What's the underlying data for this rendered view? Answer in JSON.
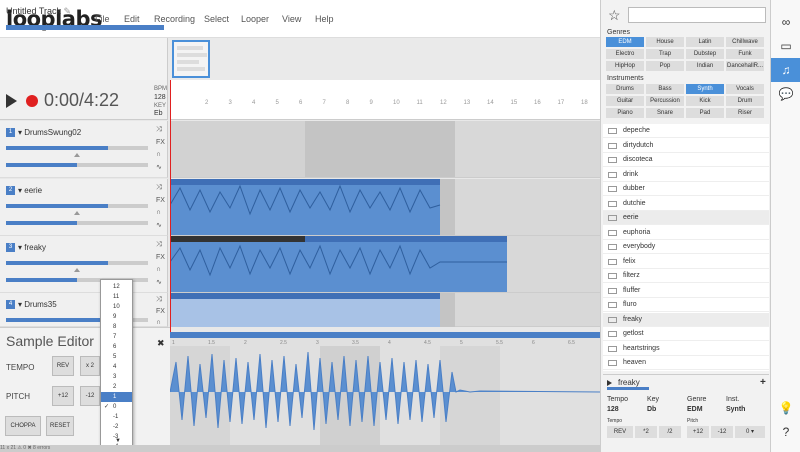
{
  "app": {
    "logo": "looplabs"
  },
  "menu": [
    "File",
    "Edit",
    "Recording",
    "Select",
    "Looper",
    "View",
    "Help"
  ],
  "track": {
    "title": "Untitled Track"
  },
  "transport": {
    "time": "0:00/4:22",
    "bpm_label": "BPM",
    "bpm": "128",
    "key_label": "KEY",
    "key": "Eb"
  },
  "ruler": {
    "ticks": [
      "2",
      "3",
      "4",
      "5",
      "6",
      "7",
      "8",
      "9",
      "10",
      "11",
      "12",
      "13",
      "14",
      "15",
      "16",
      "17",
      "18"
    ]
  },
  "tracks": [
    {
      "num": "1",
      "name": "DrumsSwung02",
      "volume": 0.72,
      "pan": 0.5
    },
    {
      "num": "2",
      "name": "eerie",
      "volume": 0.72,
      "pan": 0.5
    },
    {
      "num": "3",
      "name": "freaky",
      "volume": 0.72,
      "pan": 0.5
    },
    {
      "num": "4",
      "name": "Drums35",
      "volume": 0.72,
      "pan": 0.5
    }
  ],
  "track_icons": {
    "fx": "FX"
  },
  "sample_editor": {
    "title": "Sample Editor",
    "tempo_label": "TEMPO",
    "pitch_label": "PITCH",
    "rev": "REV",
    "x2": "x 2",
    "plus12": "+12",
    "minus12": "-12",
    "choppa": "CHOPPA",
    "reset": "RESET",
    "close": "✖"
  },
  "lower_ruler": {
    "ticks": [
      "1",
      "1.5",
      "2",
      "2.5",
      "3",
      "3.5",
      "4",
      "4.5",
      "5",
      "5.5",
      "6",
      "6.5"
    ]
  },
  "pitch_dropdown": {
    "options": [
      "12",
      "11",
      "10",
      "9",
      "8",
      "7",
      "6",
      "5",
      "4",
      "3",
      "2",
      "1",
      "0",
      "-1",
      "-2",
      "-3",
      "-4"
    ],
    "selected": "1",
    "checked": "0",
    "more": "▼"
  },
  "statusbar": {
    "text": "11   x 21   ⚠ 0   ✖ 8 errors"
  },
  "browser": {
    "genres_label": "Genres",
    "genres": [
      {
        "label": "EDM",
        "on": true
      },
      {
        "label": "House"
      },
      {
        "label": "Latin"
      },
      {
        "label": "Chillwave"
      },
      {
        "label": "Electro"
      },
      {
        "label": "Trap"
      },
      {
        "label": "Dubstep"
      },
      {
        "label": "Funk"
      },
      {
        "label": "HipHop"
      },
      {
        "label": "Pop"
      },
      {
        "label": "Indian"
      },
      {
        "label": "DancehallR..."
      }
    ],
    "instruments_label": "Instruments",
    "instruments": [
      {
        "label": "Drums"
      },
      {
        "label": "Bass"
      },
      {
        "label": "Synth",
        "on": true
      },
      {
        "label": "Vocals"
      },
      {
        "label": "Guitar"
      },
      {
        "label": "Percussion"
      },
      {
        "label": "Kick"
      },
      {
        "label": "Drum"
      },
      {
        "label": "Piano"
      },
      {
        "label": "Snare"
      },
      {
        "label": "Pad"
      },
      {
        "label": "Riser"
      }
    ],
    "loops": [
      "depeche",
      "dirtydutch",
      "discoteca",
      "drink",
      "dubber",
      "dutchie",
      "eerie",
      "euphoria",
      "everybody",
      "felix",
      "filterz",
      "fluffer",
      "fluro",
      "freaky",
      "getlost",
      "heartstrings",
      "heaven"
    ],
    "highlighted": [
      "eerie",
      "freaky"
    ]
  },
  "preview": {
    "name": "freaky",
    "add": "+",
    "headers": [
      "Tempo",
      "Key",
      "Genre",
      "Inst."
    ],
    "values": [
      "128",
      "Db",
      "EDM",
      "Synth"
    ],
    "tempo_small": "Tempo",
    "pitch_small": "Pitch",
    "buttons": [
      "REV",
      "*2",
      "/2",
      "+12",
      "-12",
      "0"
    ]
  },
  "sidebar": {
    "icons": [
      "∞",
      "▭",
      "♫",
      "💬",
      "💡",
      "?"
    ]
  },
  "colors": {
    "accent": "#4a90d9",
    "wave": "#5b8fd0",
    "record": "#e02020"
  }
}
